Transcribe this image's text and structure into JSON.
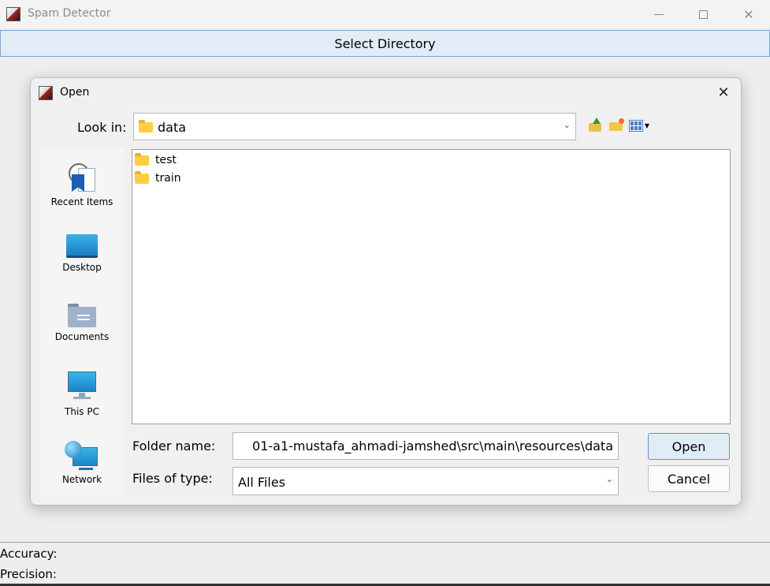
{
  "window": {
    "title": "Spam Detector",
    "select_directory_label": "Select Directory",
    "accuracy_label": "Accuracy:",
    "precision_label": "Precision:"
  },
  "dialog": {
    "title": "Open",
    "look_in_label": "Look in:",
    "look_in_value": "data",
    "places": [
      {
        "label": "Recent Items",
        "icon": "recent-items-icon"
      },
      {
        "label": "Desktop",
        "icon": "desktop-icon"
      },
      {
        "label": "Documents",
        "icon": "documents-icon"
      },
      {
        "label": "This PC",
        "icon": "this-pc-icon"
      },
      {
        "label": "Network",
        "icon": "network-icon"
      }
    ],
    "files": [
      {
        "name": "test",
        "icon": "folder-icon"
      },
      {
        "name": "train",
        "icon": "folder-icon"
      }
    ],
    "folder_name_label": "Folder name:",
    "folder_name_value": "01-a1-mustafa_ahmadi-jamshed\\src\\main\\resources\\data",
    "files_of_type_label": "Files of type:",
    "files_of_type_value": "All Files",
    "open_label": "Open",
    "cancel_label": "Cancel"
  },
  "colors": {
    "accent_button_bg": "#e1ecf7",
    "accent_border": "#5e93c8",
    "folder": "#ffcd44"
  }
}
